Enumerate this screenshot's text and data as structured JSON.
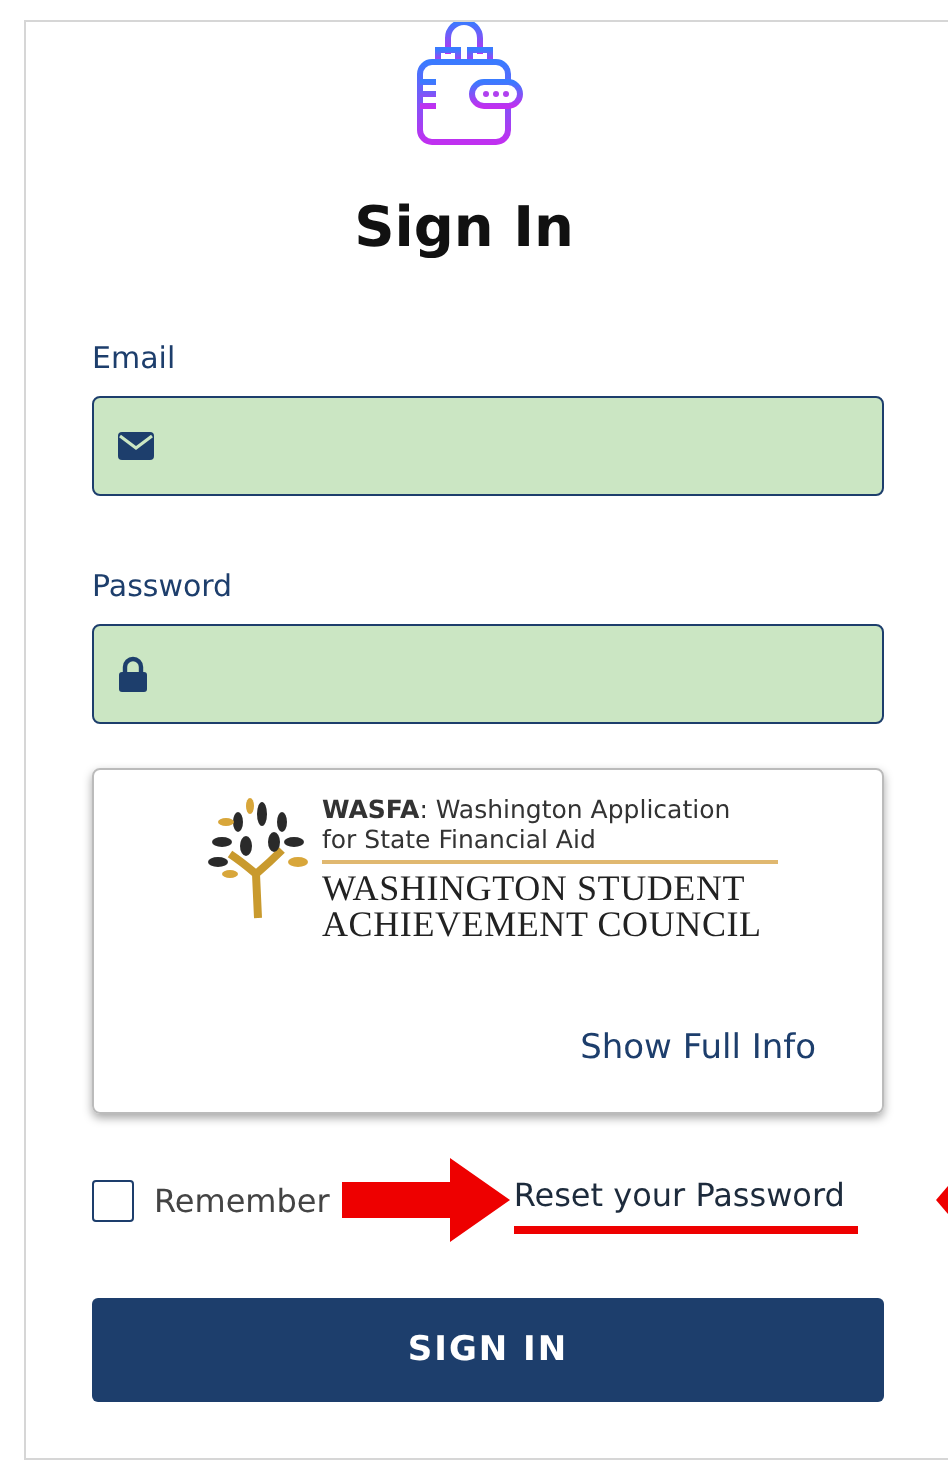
{
  "title": "Sign In",
  "fields": [
    {
      "label": "Email",
      "kind": "email"
    },
    {
      "label": "Password",
      "kind": "password"
    }
  ],
  "info_card": {
    "logo_line_1": "**WASFA**: Washington Application",
    "logo_line_2": "for State Financial Aid",
    "logo_line_3": "WASHINGTON STUDENT",
    "logo_line_4": "ACHIEVEMENT COUNCIL",
    "link": "Show Full Info"
  },
  "remember": {
    "label": "Remember",
    "checked": false
  },
  "reset_link": "Reset your Password",
  "submit": "SIGN IN"
}
